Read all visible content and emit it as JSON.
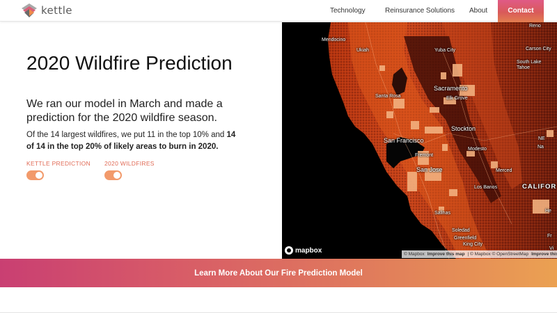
{
  "header": {
    "brand": "kettle",
    "nav": {
      "technology": "Technology",
      "reinsurance": "Reinsurance Solutions",
      "about": "About",
      "contact": "Contact"
    }
  },
  "hero": {
    "title": "2020 Wildfire Prediction",
    "subtitle": "We ran our model in March and made a prediction for the 2020 wildfire season.",
    "body_prefix": "Of the 14 largest wildfires, we put 11 in the top 10% and ",
    "body_bold": "14 of 14 in the top 20% of likely areas to burn in 2020.",
    "toggles": [
      {
        "label": "KETTLE PREDICTION",
        "on": true
      },
      {
        "label": "2020 WILDFIRES",
        "on": true
      }
    ]
  },
  "map": {
    "labels": {
      "reno": "Reno",
      "mendocino": "Mendocino",
      "ukiah": "Ukiah",
      "yuba_city": "Yuba City",
      "carson_city": "Carson City",
      "south_lake_tahoe": "South Lake Tahoe",
      "santa_rosa": "Santa Rosa",
      "sacramento": "Sacramento",
      "elk_grove": "Elk Grove",
      "stockton": "Stockton",
      "san_francisco": "San Francisco",
      "fremont": "Fremont",
      "san_jose": "San Jose",
      "modesto": "Modesto",
      "merced": "Merced",
      "los_banos": "Los Banos",
      "salinas": "Salinas",
      "soledad": "Soledad",
      "greenfield": "Greenfield",
      "king_city": "King City",
      "california": "CALIFOR",
      "ne": "NE",
      "na": "Na",
      "he": "He",
      "fr": "Fr",
      "vi": "Vi"
    },
    "logo": "mapbox",
    "attribution": {
      "mapbox": "© Mapbox",
      "improve": "Improve this map",
      "osm": "| © Mapbox © OpenStreetMap",
      "improve2": "Improve this m"
    },
    "colors": {
      "ocean": "#000000",
      "risk_low": "#4a0f08",
      "risk_mid": "#a32c10",
      "risk_high": "#e05a1c",
      "wildfire": "#f3b07e"
    }
  },
  "cta": {
    "label": "Learn More About Our Fire Prediction Model"
  },
  "colors": {
    "accent": "#e06a55",
    "toggle": "#f29a6b"
  }
}
